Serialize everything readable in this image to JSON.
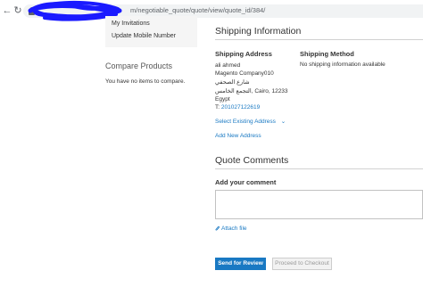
{
  "browser": {
    "back_icon": "back-arrow-icon",
    "reload_icon": "reload-icon",
    "back_glyph": "←",
    "reload_glyph": "↻",
    "url": "m/negotiable_quote/quote/view/quote_id/384/",
    "redaction_color": "#1a1aff"
  },
  "sidebar": {
    "items": [
      {
        "label": "My Invitations"
      },
      {
        "label": "Update Mobile Number"
      }
    ],
    "compare": {
      "title": "Compare Products",
      "empty_text": "You have no items to compare."
    }
  },
  "shipping": {
    "title": "Shipping Information",
    "address": {
      "heading": "Shipping Address",
      "name": "ali ahmed",
      "company": "Magento Company010",
      "street": "شارع الصحفي",
      "city_line": "التجمع الخامس, Cairo, 12233",
      "country": "Egypt",
      "phone_prefix": "T: ",
      "phone": "201027122619"
    },
    "method": {
      "heading": "Shipping Method",
      "text": "No shipping information available"
    },
    "select_existing_label": "Select Existing Address",
    "add_new_label": "Add New Address"
  },
  "comments": {
    "title": "Quote Comments",
    "add_label": "Add your comment",
    "textarea_value": "",
    "attach_label": "Attach file"
  },
  "actions": {
    "send_label": "Send for Review",
    "checkout_label": "Proceed to Checkout"
  },
  "colors": {
    "link": "#1979c3",
    "primary_button": "#1979c3",
    "disabled_button_text": "#9a9a9a"
  }
}
